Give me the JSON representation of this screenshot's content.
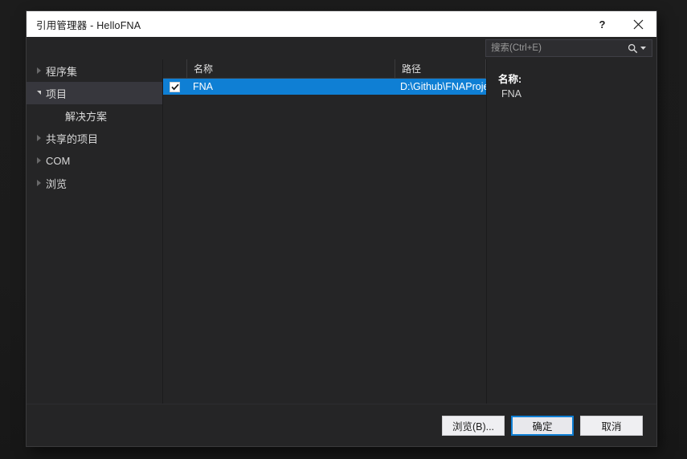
{
  "window": {
    "title": "引用管理器 - HelloFNA",
    "help_tooltip": "?",
    "close_tooltip": "✕"
  },
  "search": {
    "placeholder": "搜索(Ctrl+E)",
    "value": "",
    "icon": "search-icon",
    "dropdown_icon": "chevron-down-icon"
  },
  "sidebar": {
    "items": [
      {
        "label": "程序集",
        "state": "collapsed",
        "selected": false,
        "child": false
      },
      {
        "label": "项目",
        "state": "expanded",
        "selected": true,
        "child": false
      },
      {
        "label": "解决方案",
        "state": "leaf",
        "selected": false,
        "child": true
      },
      {
        "label": "共享的项目",
        "state": "collapsed",
        "selected": false,
        "child": false
      },
      {
        "label": "COM",
        "state": "collapsed",
        "selected": false,
        "child": false
      },
      {
        "label": "浏览",
        "state": "collapsed",
        "selected": false,
        "child": false
      }
    ]
  },
  "list": {
    "columns": [
      {
        "key": "checkbox",
        "label": ""
      },
      {
        "key": "name",
        "label": "名称"
      },
      {
        "key": "path",
        "label": "路径"
      }
    ],
    "rows": [
      {
        "checked": true,
        "name": "FNA",
        "path": "D:\\Github\\FNAProje...",
        "selected": true
      }
    ]
  },
  "detail": {
    "name_label": "名称:",
    "name_value": "FNA"
  },
  "footer": {
    "browse_label": "浏览(B)...",
    "ok_label": "确定",
    "cancel_label": "取消"
  },
  "colors": {
    "accent": "#0f7fd4",
    "dialog_bg": "#252526",
    "titlebar_bg": "#ffffff",
    "selection_bg": "#0f7fd4",
    "tree_selected_bg": "#37373d"
  }
}
